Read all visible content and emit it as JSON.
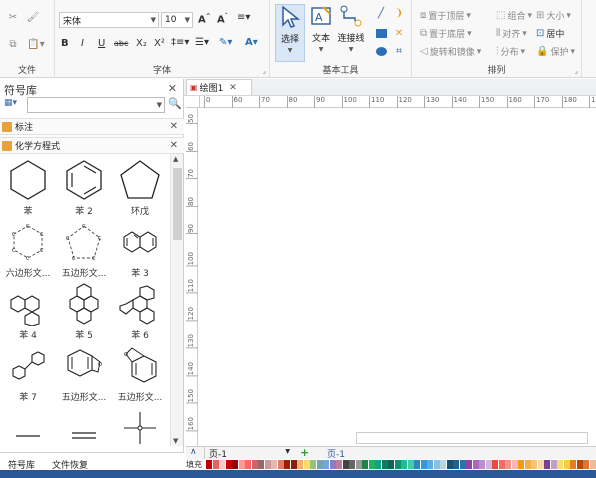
{
  "ribbon": {
    "groups": {
      "file": "文件",
      "font": "字体",
      "basic_tools": "基本工具",
      "arrange": "排列"
    },
    "font_name": "宋体",
    "font_size": "10",
    "tools": {
      "select": "选择",
      "text": "文本",
      "connector": "连接线"
    },
    "arrange_items": {
      "bring_front": "置于顶层",
      "send_back": "置于底层",
      "rotate_mirror": "旋转和镜像",
      "group": "组合",
      "align": "对齐",
      "distribute": "分布",
      "size": "大小",
      "center": "居中",
      "protect": "保护"
    }
  },
  "left_panel": {
    "title": "符号库",
    "categories": [
      "标注",
      "化学方程式"
    ],
    "shapes": [
      "苯",
      "苯 2",
      "环戊",
      "六边形文...",
      "五边形文...",
      "苯 3",
      "苯 4",
      "苯 5",
      "苯 6",
      "苯 7",
      "五边形文...",
      "五边形文..."
    ],
    "bottom_tabs": [
      "符号库",
      "文件恢复"
    ]
  },
  "document": {
    "tab_title": "绘图1",
    "ruler_h": [
      "0",
      "60",
      "70",
      "80",
      "90",
      "100",
      "110",
      "120",
      "130",
      "140",
      "150",
      "160",
      "170",
      "180",
      "190"
    ],
    "ruler_v": [
      "50",
      "60",
      "70",
      "80",
      "90",
      "100",
      "110",
      "120",
      "130",
      "140",
      "150",
      "160"
    ],
    "page_combo": "页-1",
    "page_tab": "页-1",
    "fill_label": "填充"
  },
  "colors": {
    "accent": "#2b5796",
    "palette": [
      "#c00000",
      "#e06666",
      "#f4cccc",
      "#cc0000",
      "#990000",
      "#ff9999",
      "#ff6666",
      "#cc6666",
      "#996666",
      "#cc9999",
      "#e6b8af",
      "#dd7e6b",
      "#a61c00",
      "#85200c",
      "#f6b26b",
      "#ffd966",
      "#93c47d",
      "#76a5af",
      "#6fa8dc",
      "#8e7cc3",
      "#c27ba0",
      "#434343",
      "#666666",
      "#999999",
      "#1e8449",
      "#27ae60",
      "#16a085",
      "#117a65",
      "#0e6655",
      "#148f77",
      "#1abc9c",
      "#48c9b0",
      "#2e86c1",
      "#3498db",
      "#5dade2",
      "#85c1e9",
      "#aed6f1",
      "#1b4f72",
      "#21618c",
      "#2874a6",
      "#8e44ad",
      "#a569bd",
      "#bb8fce",
      "#d2b4de",
      "#e74c3c",
      "#ec7063",
      "#f1948a",
      "#f5b7b1",
      "#f39c12",
      "#f5b041",
      "#f8c471",
      "#fad7a0",
      "#7d3c98",
      "#c39bd3",
      "#f7dc6f",
      "#f4d03f",
      "#e67e22",
      "#ba4a00",
      "#dc7633",
      "#edbb99"
    ]
  }
}
